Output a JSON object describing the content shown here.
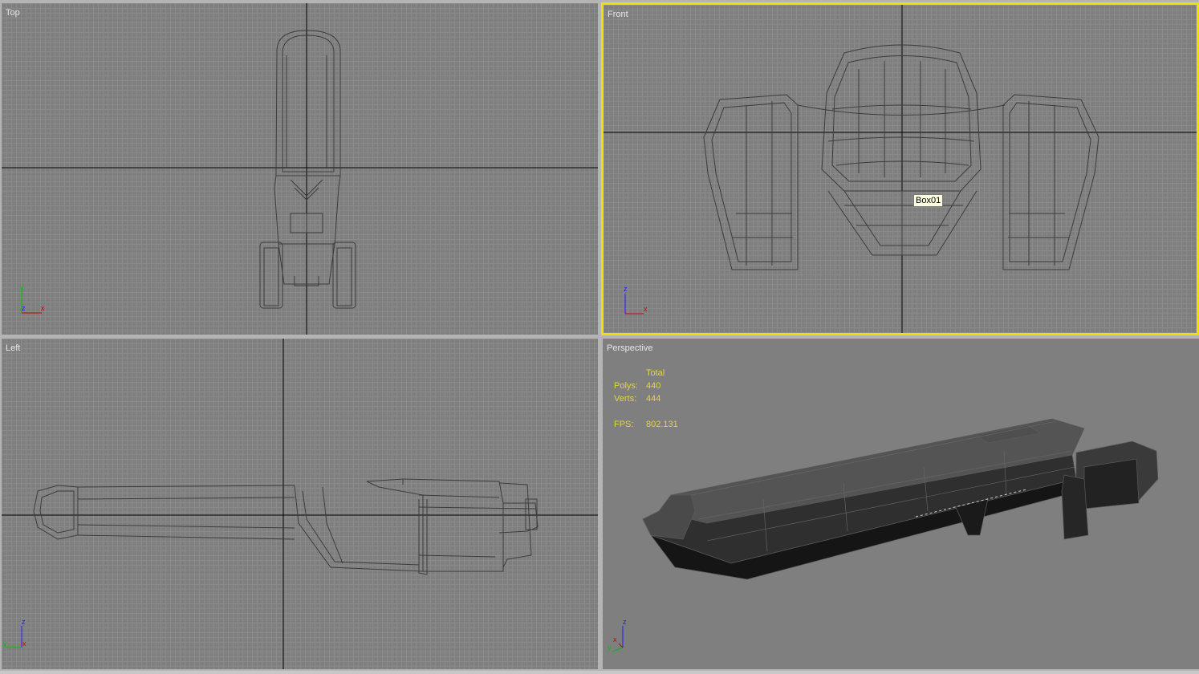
{
  "viewports": {
    "top": {
      "label": "Top"
    },
    "front": {
      "label": "Front",
      "active": true,
      "highlight_color": "#f0e000"
    },
    "left": {
      "label": "Left"
    },
    "perspective": {
      "label": "Perspective"
    }
  },
  "object_tooltip": "Box01",
  "stats": {
    "header": "Total",
    "polys_label": "Polys:",
    "polys_value": "440",
    "verts_label": "Verts:",
    "verts_value": "444",
    "fps_label": "FPS:",
    "fps_value": "802.131"
  },
  "axis_tripods": {
    "top": [
      "y",
      "z",
      "x"
    ],
    "front": [
      "z",
      "x"
    ],
    "left": [
      "z",
      "y",
      "x"
    ],
    "perspective": [
      "z",
      "y",
      "x"
    ]
  },
  "colors": {
    "viewport_bg": "#7f7f7f",
    "grid": "#8a8a8a",
    "wireframe": "#3c3c3c",
    "stats_text": "#e2d544",
    "active_border": "#f0e000",
    "axis_x": "#d00000",
    "axis_y": "#00c000",
    "axis_z": "#1c1cff"
  }
}
